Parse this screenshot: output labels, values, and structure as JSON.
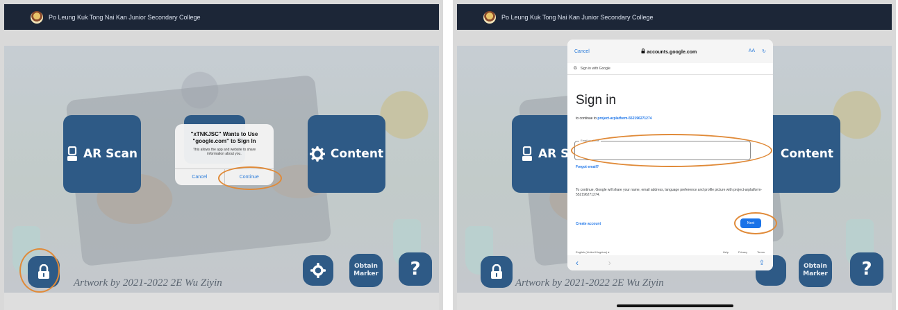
{
  "header": {
    "school_name": "Po Leung Kuk Tong Nai Kan Junior Secondary College"
  },
  "menu": {
    "ar_scan_label": "AR Scan",
    "ar_scan_label_partial": "AR S",
    "content_label": "Content",
    "obtain_marker_line1": "Obtain",
    "obtain_marker_line2": "Marker",
    "help_label": "?"
  },
  "artwork_credit": "Artwork by 2021-2022 2E Wu Ziyin",
  "icons": {
    "lock": "lock-icon",
    "gear": "gear-icon",
    "scanner": "scanner-icon",
    "school_logo": "school-logo-icon",
    "back": "back-arrow-icon",
    "forward": "forward-arrow-icon",
    "share": "share-icon",
    "reload": "reload-icon"
  },
  "alert": {
    "title": "\"xTNKJSC\" Wants to Use \"google.com\" to Sign In",
    "message": "This allows the app and website to share information about you.",
    "cancel_label": "Cancel",
    "continue_label": "Continue"
  },
  "signin": {
    "cancel_label": "Cancel",
    "url": "accounts.google.com",
    "text_size_label": "AA",
    "strip_label": "Sign in with Google",
    "title": "Sign in",
    "subtitle_prefix": "to continue to",
    "project_id": "project-arplatform-552196271274",
    "email_placeholder": "Email or phone",
    "forgot_email": "Forgot email?",
    "info_text": "To continue, Google will share your name, email address, language preference and profile picture with project-arplatform-552196271274.",
    "create_account": "Create account",
    "next_label": "Next",
    "language": "English (United Kingdom)",
    "help": "Help",
    "privacy": "Privacy",
    "terms": "Terms"
  },
  "colors": {
    "topbar": "#1c2637",
    "tile_blue": "#2e5a86",
    "highlight_orange": "#e08a38",
    "link_blue": "#1a73e8",
    "ios_blue": "#2a7bd9"
  }
}
